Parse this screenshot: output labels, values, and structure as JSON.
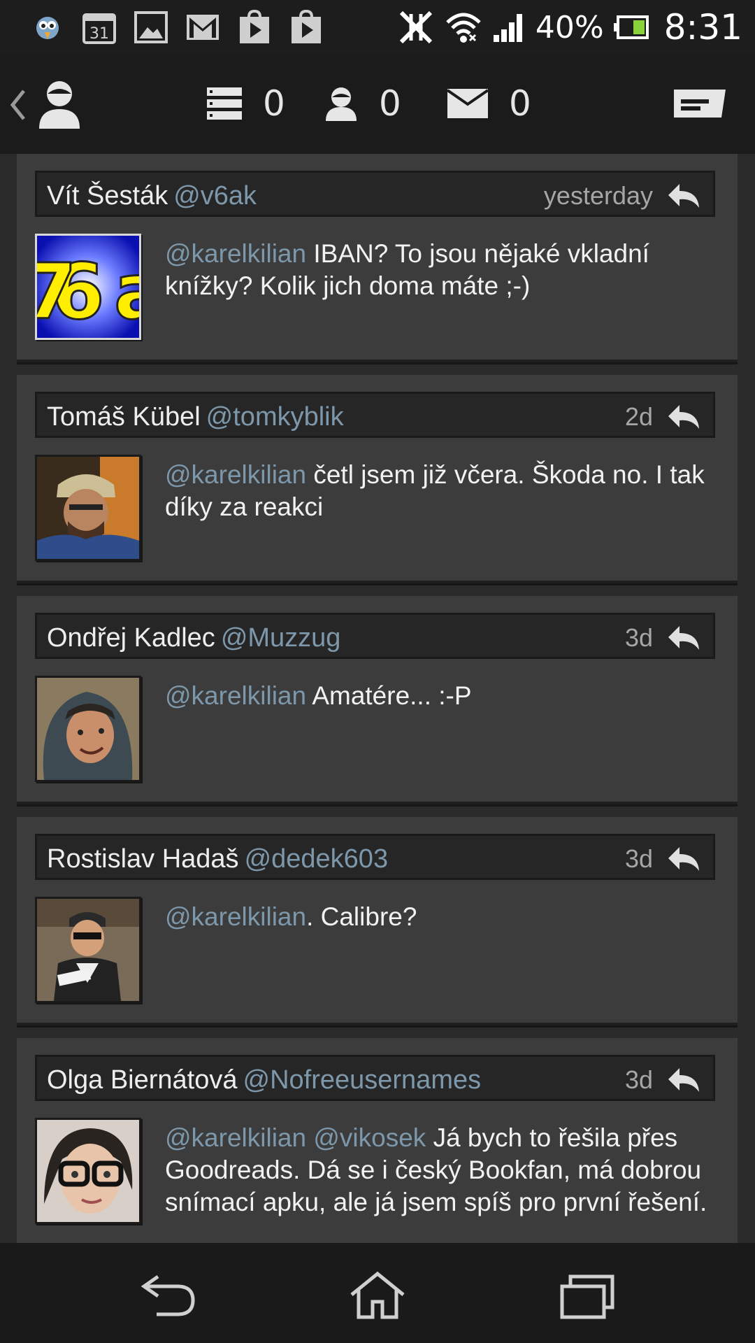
{
  "statusbar": {
    "notification_icons": [
      "bird-app-icon",
      "calendar-31-icon",
      "gallery-icon",
      "gmail-icon",
      "play-store-icon",
      "play-store-icon"
    ],
    "calendar_day": "31",
    "battery_percent": "40%",
    "time": "8:31"
  },
  "topnav": {
    "counters": [
      {
        "icon": "list-icon",
        "value": "0"
      },
      {
        "icon": "mention-user-icon",
        "value": "0"
      },
      {
        "icon": "message-icon",
        "value": "0"
      }
    ]
  },
  "tweets": [
    {
      "name": "Vít Šesták",
      "handle": "@v6ak",
      "time": "yesterday",
      "mentions": "@karelkilian",
      "text": " IBAN? To jsou nějaké vkladní knížky? Kolik jich doma máte ;-)",
      "avatar": "v6ak-logo"
    },
    {
      "name": "Tomáš Kübel",
      "handle": "@tomkyblik",
      "time": "2d",
      "mentions": "@karelkilian",
      "text": " četl jsem již včera. Škoda no. I tak díky za reakci",
      "avatar": "man-cap-photo"
    },
    {
      "name": "Ondřej Kadlec",
      "handle": "@Muzzug",
      "time": "3d",
      "mentions": "@karelkilian",
      "text": " Amatére... :-P",
      "avatar": "hooded-face-photo"
    },
    {
      "name": "Rostislav Hadaš",
      "handle": "@dedek603",
      "time": "3d",
      "mentions": "@karelkilian",
      "text": ". Calibre?",
      "avatar": "man-sunglasses-photo"
    },
    {
      "name": "Olga Biernátová",
      "handle": "@Nofreeusernames",
      "time": "3d",
      "mentions": "@karelkilian @vikosek",
      "text": " Já bych to řešila přes Goodreads. Dá se i český Bookfan, má dobrou snímací apku, ale já jsem spíš pro první řešení.",
      "avatar": "woman-glasses-photo"
    }
  ],
  "colors": {
    "accent": "#7d97ab",
    "card": "#3c3c3c",
    "background": "#232323"
  }
}
